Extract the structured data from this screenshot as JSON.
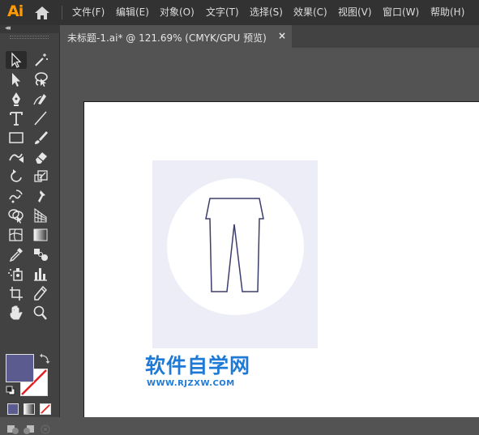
{
  "app": {
    "logo": "Ai"
  },
  "menu": [
    {
      "label": "文件(F)"
    },
    {
      "label": "编辑(E)"
    },
    {
      "label": "对象(O)"
    },
    {
      "label": "文字(T)"
    },
    {
      "label": "选择(S)"
    },
    {
      "label": "效果(C)"
    },
    {
      "label": "视图(V)"
    },
    {
      "label": "窗口(W)"
    },
    {
      "label": "帮助(H)"
    }
  ],
  "document_tab": {
    "title": "未标题-1.ai* @ 121.69% (CMYK/GPU 预览)",
    "close": "×"
  },
  "toolbar": {
    "collapse": "◂◂",
    "tools": [
      "selection-tool",
      "magic-wand-tool",
      "direct-selection-tool",
      "lasso-tool",
      "pen-tool",
      "curvature-tool",
      "type-tool",
      "line-segment-tool",
      "rectangle-tool",
      "paintbrush-tool",
      "shaper-tool",
      "eraser-tool",
      "rotate-tool",
      "scale-tool",
      "warp-tool",
      "puppet-warp-tool",
      "shape-builder-tool",
      "perspective-grid-tool",
      "mesh-tool",
      "gradient-tool",
      "eyedropper-tool",
      "blend-tool",
      "symbol-sprayer-tool",
      "column-graph-tool",
      "artboard-tool",
      "slice-tool",
      "hand-tool",
      "zoom-tool"
    ],
    "fill_color": "#5b5b8f",
    "stroke": "none"
  },
  "canvas": {
    "artwork_bg_color": "#ededf7",
    "icon_color": "#3d3d6b",
    "icon": "pants-icon"
  },
  "watermark": {
    "title": "软件自学网",
    "url": "WWW.RJZXW.COM"
  }
}
